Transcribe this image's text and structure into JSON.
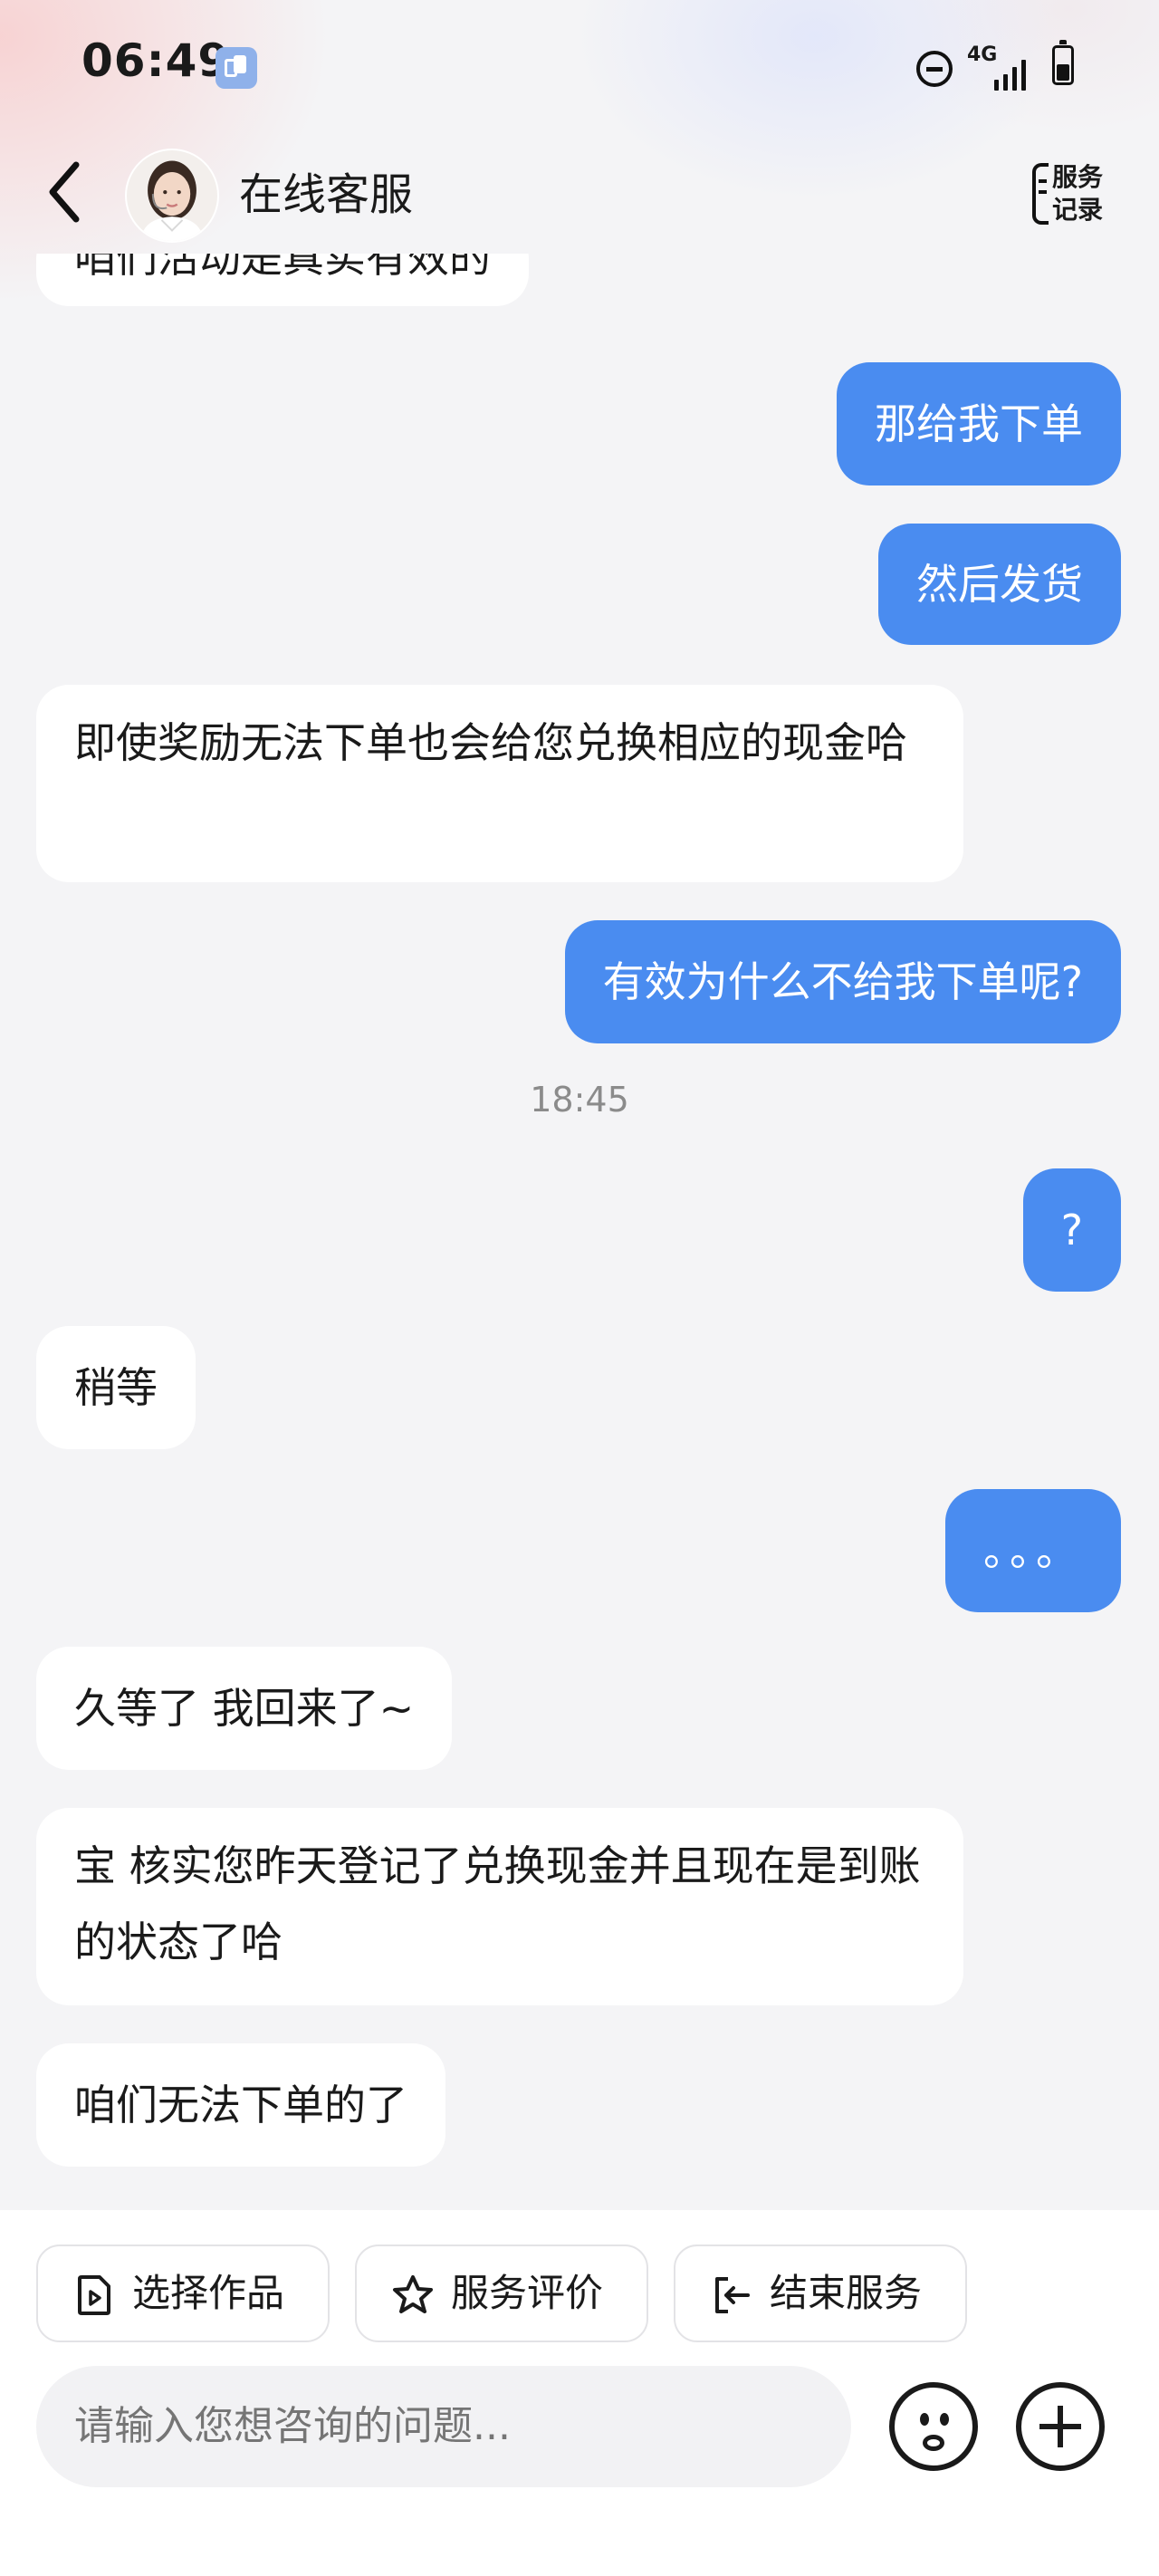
{
  "status_bar": {
    "time": "06:49",
    "network": "4G",
    "icons": [
      "clipboard-icon",
      "do-not-disturb-icon",
      "signal-icon",
      "battery-icon"
    ]
  },
  "header": {
    "title": "在线客服",
    "service_record_line1": "服务",
    "service_record_line2": "记录",
    "icons": [
      "back-icon",
      "avatar",
      "service-record-icon"
    ]
  },
  "chat": {
    "partial_top_message": "咱们活动是真实有效的",
    "messages": [
      {
        "from": "user",
        "text": "那给我下单"
      },
      {
        "from": "user",
        "text": "然后发货"
      },
      {
        "from": "agent",
        "text": "即使奖励无法下单也会给您兑换相应的现金哈"
      },
      {
        "from": "user",
        "text": "有效为什么不给我下单呢?"
      },
      {
        "type": "timestamp",
        "text": "18:45"
      },
      {
        "from": "user",
        "text": "?"
      },
      {
        "from": "agent",
        "text": "稍等"
      },
      {
        "from": "user",
        "text": "。。。"
      },
      {
        "from": "agent",
        "text": "久等了 我回来了~"
      },
      {
        "from": "agent",
        "text": "宝 核实您昨天登记了兑换现金并且现在是到账的状态了哈"
      },
      {
        "from": "agent",
        "text": "咱们无法下单的了"
      }
    ]
  },
  "footer": {
    "actions": [
      {
        "label": "选择作品",
        "icon": "video-file-icon"
      },
      {
        "label": "服务评价",
        "icon": "star-icon"
      },
      {
        "label": "结束服务",
        "icon": "exit-icon"
      }
    ],
    "input_placeholder": "请输入您想咨询的问题...",
    "icons": [
      "emoji-icon",
      "plus-icon"
    ]
  },
  "colors": {
    "user_bubble": "#4a8cf0",
    "agent_bubble": "#ffffff",
    "background": "#f4f4f6"
  }
}
